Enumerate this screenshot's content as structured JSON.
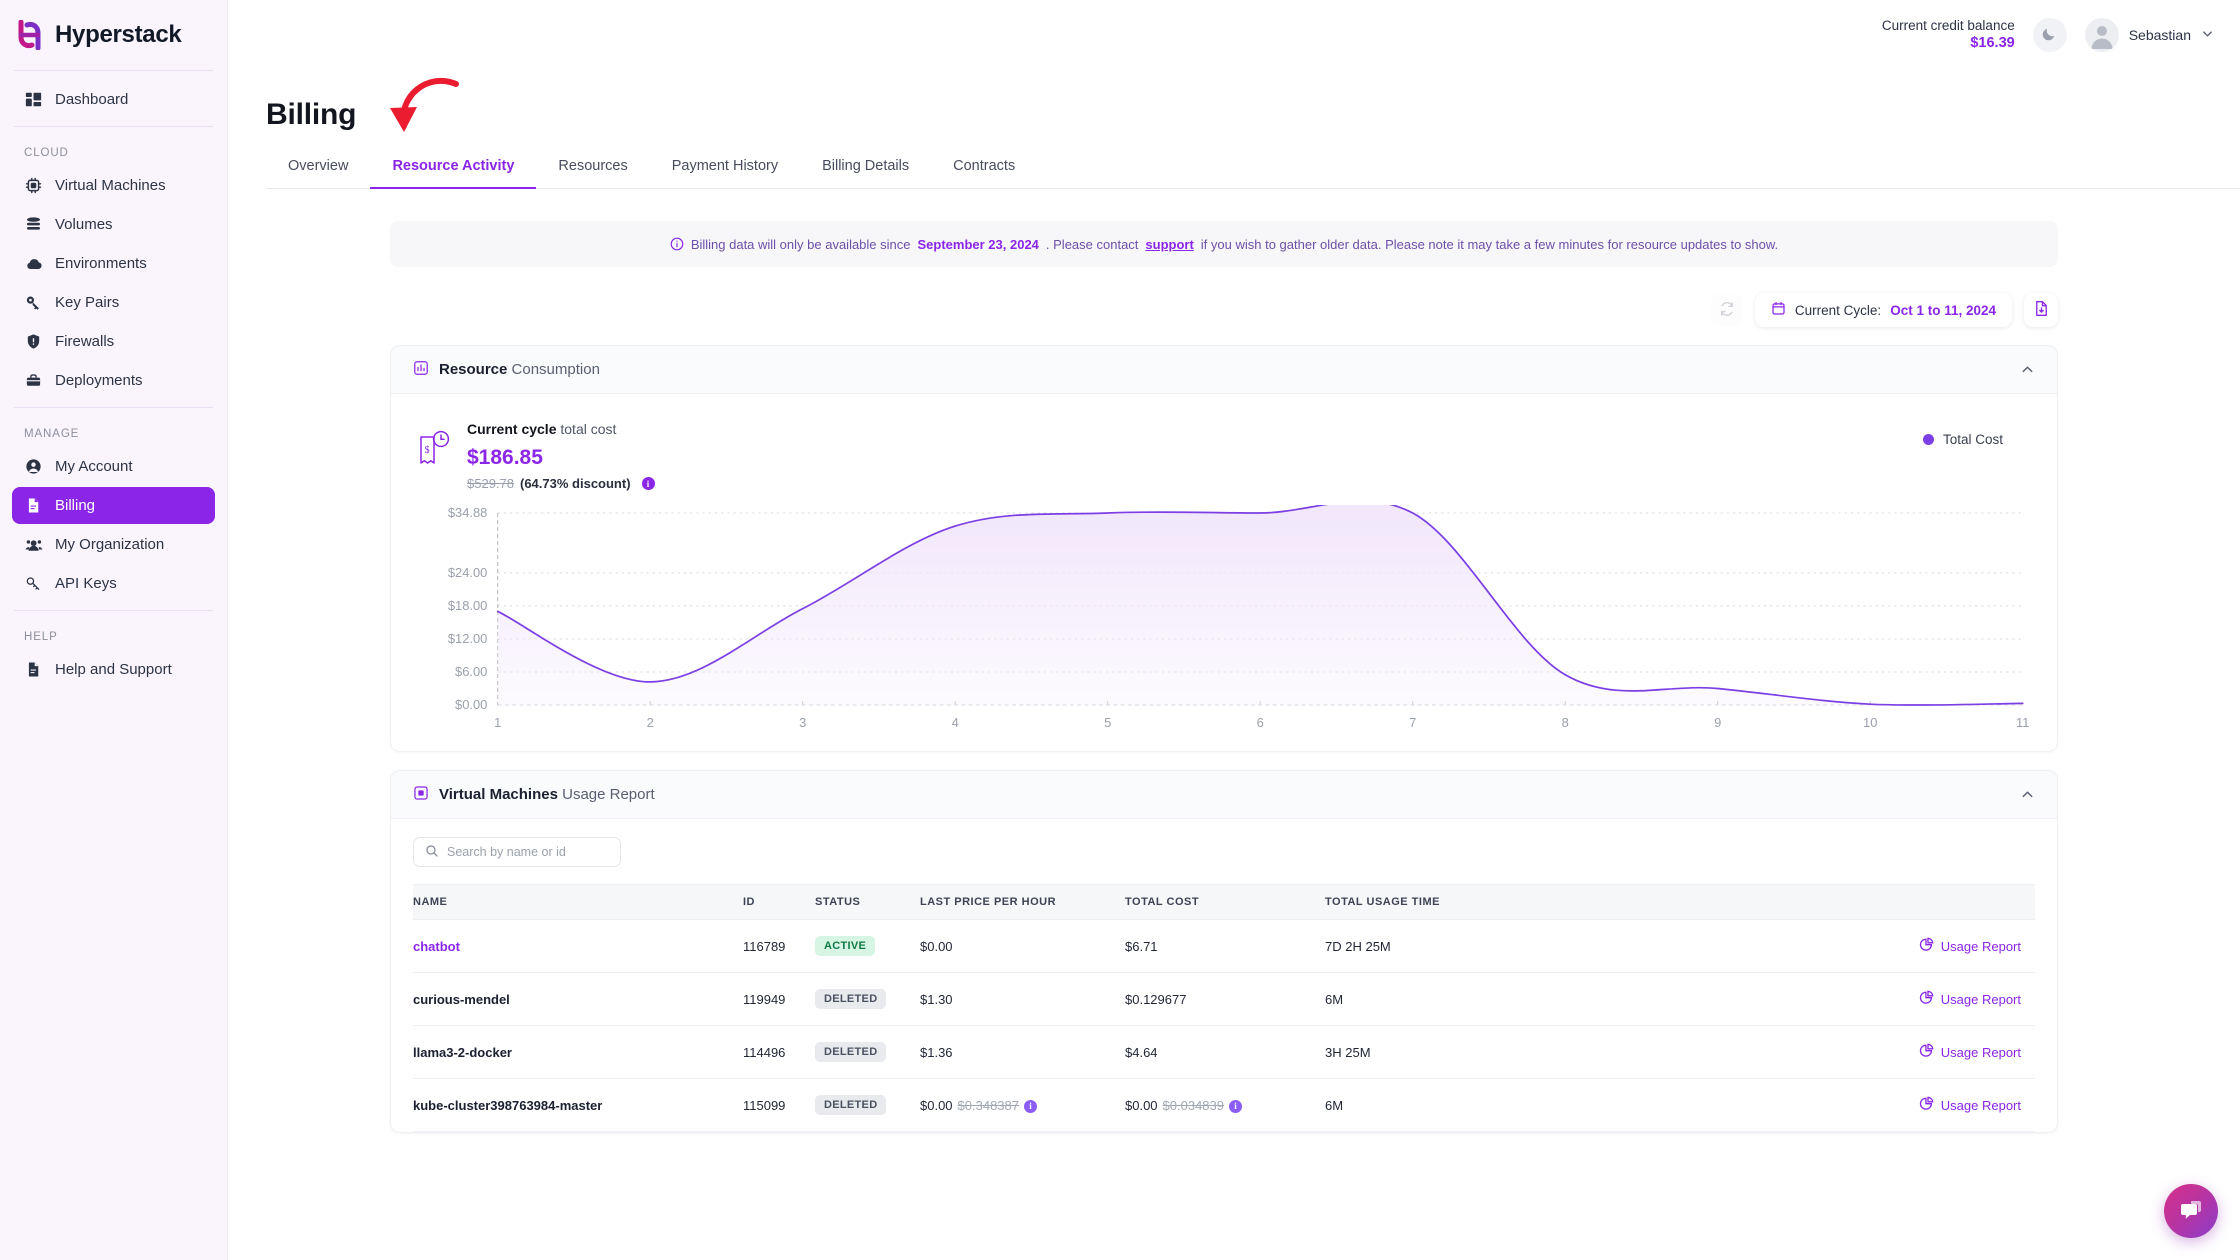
{
  "brand": {
    "name": "Hyperstack"
  },
  "topbar": {
    "credit_label": "Current credit balance",
    "credit_value": "$16.39",
    "theme_icon": "moon-icon",
    "user_name": "Sebastian"
  },
  "sidebar": {
    "primary": [
      {
        "label": "Dashboard",
        "icon": "dashboard-icon"
      }
    ],
    "groups": [
      {
        "heading": "CLOUD",
        "items": [
          {
            "label": "Virtual Machines",
            "icon": "cpu-icon"
          },
          {
            "label": "Volumes",
            "icon": "database-icon"
          },
          {
            "label": "Environments",
            "icon": "cloud-icon"
          },
          {
            "label": "Key Pairs",
            "icon": "key-icon"
          },
          {
            "label": "Firewalls",
            "icon": "shield-icon"
          },
          {
            "label": "Deployments",
            "icon": "briefcase-icon"
          }
        ]
      },
      {
        "heading": "MANAGE",
        "items": [
          {
            "label": "My Account",
            "icon": "user-circle-icon",
            "active": false
          },
          {
            "label": "Billing",
            "icon": "document-icon",
            "active": true
          },
          {
            "label": "My Organization",
            "icon": "users-icon",
            "active": false
          },
          {
            "label": "API Keys",
            "icon": "api-key-icon",
            "active": false
          }
        ]
      },
      {
        "heading": "HELP",
        "items": [
          {
            "label": "Help and Support",
            "icon": "help-doc-icon"
          }
        ]
      }
    ]
  },
  "page": {
    "title": "Billing",
    "annotation": "red-curved-arrow pointing to Resource Activity tab",
    "tabs": [
      {
        "label": "Overview",
        "active": false
      },
      {
        "label": "Resource Activity",
        "active": true
      },
      {
        "label": "Resources",
        "active": false
      },
      {
        "label": "Payment History",
        "active": false
      },
      {
        "label": "Billing Details",
        "active": false
      },
      {
        "label": "Contracts",
        "active": false
      }
    ]
  },
  "banner": {
    "icon": "info-circle-icon",
    "text_1": "Billing data will only be available since ",
    "date": "September 23, 2024",
    "text_2": ". Please contact ",
    "link": "support",
    "text_3": " if you wish to gather older data. Please note it may take a few minutes for resource updates to show."
  },
  "cyclebar": {
    "refresh_icon": "refresh-icon",
    "calendar_icon": "calendar-icon",
    "cycle_label": "Current Cycle: ",
    "cycle_value": "Oct 1 to 11, 2024",
    "download_icon": "download-file-icon"
  },
  "consumption": {
    "icon": "bar-chart-icon",
    "title_bold": "Resource",
    "title_rest": " Consumption",
    "collapse_icon": "chevron-up-icon",
    "cost_icon": "receipt-clock-icon",
    "cost_label_bold": "Current cycle",
    "cost_label_rest": " total cost",
    "cost_total": "$186.85",
    "cost_original": "$529.78",
    "cost_discount": "(64.73% discount)",
    "info_icon": "info-icon",
    "legend_label": "Total Cost",
    "legend_color": "#7b3fe4"
  },
  "chart_data": {
    "type": "area",
    "title": "Resource Consumption - Total Cost",
    "xlabel": "",
    "ylabel": "",
    "legend": [
      "Total Cost"
    ],
    "legend_position": "top-right",
    "grid": true,
    "x": [
      1,
      2,
      3,
      4,
      5,
      6,
      7,
      8,
      9,
      10,
      11
    ],
    "xticklabels": [
      "1",
      "2",
      "3",
      "4",
      "5",
      "6",
      "7",
      "8",
      "9",
      "10",
      "11"
    ],
    "yticklabels": [
      "$0.00",
      "$6.00",
      "$12.00",
      "$18.00",
      "$24.00",
      "$34.88"
    ],
    "yticks": [
      0,
      6,
      12,
      18,
      24,
      34.88
    ],
    "ylim": [
      0,
      34.88
    ],
    "series": [
      {
        "name": "Total Cost",
        "color": "#7b3fe4",
        "fill": "#f1e6fb",
        "values": [
          17.0,
          4.2,
          17.5,
          32.5,
          34.88,
          34.88,
          34.88,
          5.5,
          3.0,
          0.15,
          0.3
        ]
      }
    ]
  },
  "vm_report": {
    "icon": "cpu-chip-icon",
    "title_bold": "Virtual Machines",
    "title_rest": " Usage Report",
    "collapse_icon": "chevron-up-icon",
    "search_placeholder": "Search by name or id",
    "search_value": "",
    "search_icon": "search-icon",
    "columns": [
      "NAME",
      "ID",
      "STATUS",
      "LAST PRICE PER HOUR",
      "TOTAL COST",
      "TOTAL USAGE TIME"
    ],
    "action_label": "Usage Report",
    "action_icon": "usage-report-icon",
    "rows": [
      {
        "name": "chatbot",
        "name_is_link": true,
        "id": "116789",
        "status": "ACTIVE",
        "status_kind": "active",
        "last_price": "$0.00",
        "last_price_strike": "",
        "last_price_info": false,
        "total_cost": "$6.71",
        "total_cost_strike": "",
        "total_cost_info": false,
        "usage_time": "7D 2H 25M"
      },
      {
        "name": "curious-mendel",
        "name_is_link": false,
        "id": "119949",
        "status": "DELETED",
        "status_kind": "deleted",
        "last_price": "$1.30",
        "last_price_strike": "",
        "last_price_info": false,
        "total_cost": "$0.129677",
        "total_cost_strike": "",
        "total_cost_info": false,
        "usage_time": "6M"
      },
      {
        "name": "llama3-2-docker",
        "name_is_link": false,
        "id": "114496",
        "status": "DELETED",
        "status_kind": "deleted",
        "last_price": "$1.36",
        "last_price_strike": "",
        "last_price_info": false,
        "total_cost": "$4.64",
        "total_cost_strike": "",
        "total_cost_info": false,
        "usage_time": "3H 25M"
      },
      {
        "name": "kube-cluster398763984-master",
        "name_is_link": false,
        "id": "115099",
        "status": "DELETED",
        "status_kind": "deleted",
        "last_price": "$0.00",
        "last_price_strike": "$0.348387",
        "last_price_info": true,
        "total_cost": "$0.00",
        "total_cost_strike": "$0.034839",
        "total_cost_info": true,
        "usage_time": "6M"
      }
    ]
  },
  "chat_widget": {
    "icon": "chat-bubble-icon"
  }
}
